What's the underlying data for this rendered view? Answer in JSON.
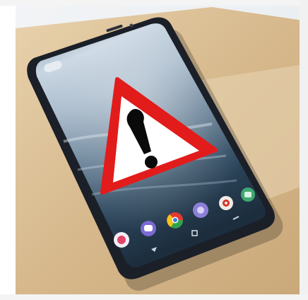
{
  "image": {
    "subject": "smartphone-with-warning-sign",
    "colors": {
      "background": "#ffffff",
      "box": "#d7b98f",
      "phone_body": "#1b1f27",
      "screen_sky": "#cfdbe6",
      "screen_water": "#2f4b63",
      "warning_red": "#e21b1b",
      "warning_white": "#ffffff",
      "mark_black": "#0a0a0a"
    },
    "icons": [
      "warning-triangle-icon",
      "exclamation-mark-icon",
      "phone-app-icon",
      "messages-app-icon",
      "chrome-app-icon",
      "camera-app-icon",
      "play-store-app-icon",
      "back-nav-icon",
      "home-nav-icon",
      "recents-nav-icon"
    ]
  }
}
